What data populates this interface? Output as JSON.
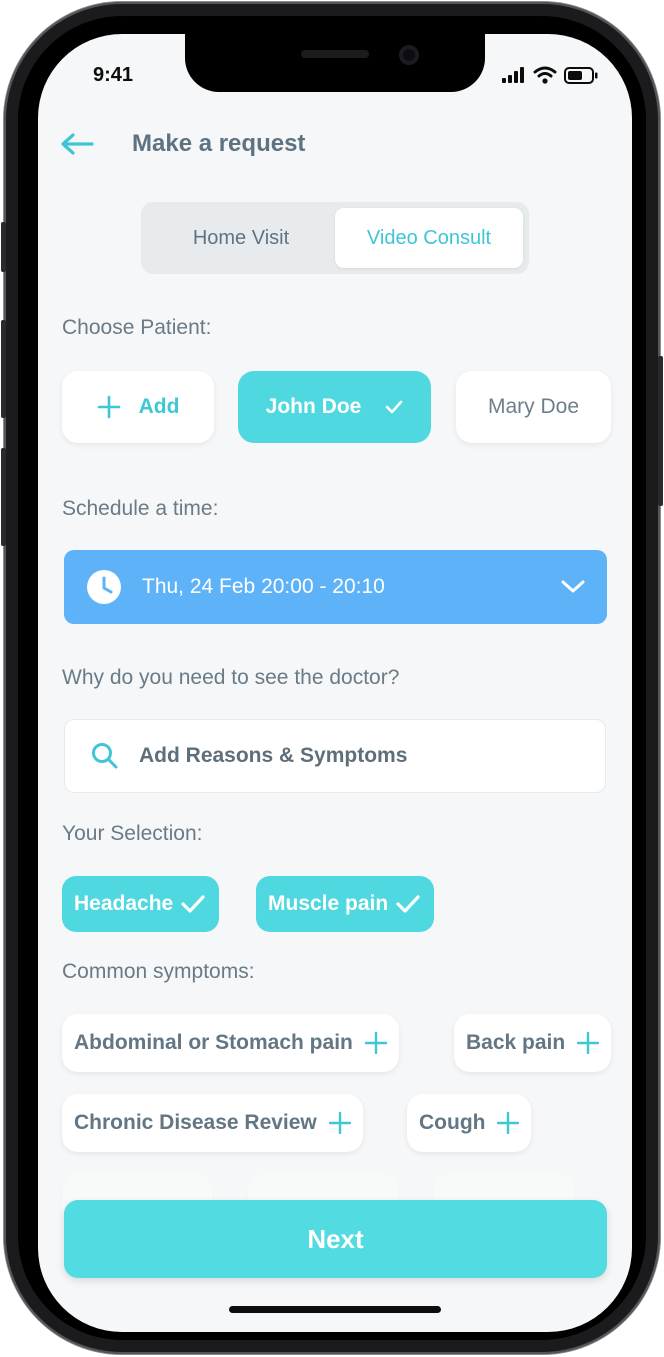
{
  "status_bar": {
    "time": "9:41"
  },
  "header": {
    "title": "Make a request"
  },
  "visit_type": {
    "options": [
      "Home Visit",
      "Video Consult"
    ],
    "selected": "Video Consult"
  },
  "patient": {
    "label": "Choose Patient:",
    "add_label": "Add",
    "options": [
      {
        "name": "John Doe",
        "selected": true
      },
      {
        "name": "Mary Doe",
        "selected": false
      }
    ]
  },
  "schedule": {
    "label": "Schedule a time:",
    "value": "Thu, 24 Feb 20:00 - 20:10"
  },
  "reasons": {
    "label": "Why do you need to see the doctor?",
    "search_placeholder": "Add Reasons & Symptoms"
  },
  "selection": {
    "label": "Your Selection:",
    "items": [
      "Headache",
      "Muscle pain"
    ]
  },
  "common": {
    "label": "Common symptoms:",
    "items": [
      "Abdominal or Stomach pain",
      "Back pain",
      "Chronic Disease Review",
      "Cough"
    ]
  },
  "next_label": "Next",
  "colors": {
    "accent": "#4fd8df",
    "schedule": "#5db2f8",
    "title": "#5e7382"
  }
}
